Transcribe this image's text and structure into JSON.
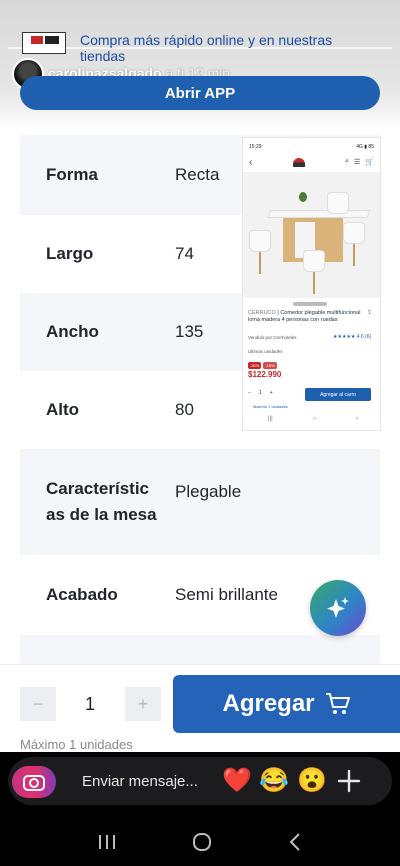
{
  "specs": [
    {
      "key": "Forma",
      "value": "Recta"
    },
    {
      "key": "Largo",
      "value": "74"
    },
    {
      "key": "Ancho",
      "value": "135"
    },
    {
      "key": "Alto",
      "value": "80"
    },
    {
      "key": "Características de la mesa",
      "key_display": "Característic\nas de la mesa",
      "value": "Plegable"
    },
    {
      "key": "Acabado",
      "value": "Semi brillante"
    }
  ],
  "story": {
    "promo_text": "Compra más rápido online y en nuestras tiendas",
    "username": "carolinazsalgado",
    "meta": "a ti  12 min",
    "open_app_label": "Abrir APP"
  },
  "shot": {
    "status_time": "15:29",
    "status_right": "4G ▮ 85",
    "title_brand": "CERRUCO",
    "title_text": "Comedor plegable multifuncional loma madera 4 personas con ruedas",
    "sold_by": "Vendido por Cerrhoteles",
    "rating": "★★★★★ 4.6 (6)",
    "badge": "Ultimas unidades",
    "tags": [
      "-30%",
      "-15%"
    ],
    "price": "$122.990",
    "qty": "1",
    "add_label": "Agregar al carro",
    "max_label": "Máximo 1 unidades"
  },
  "buy": {
    "minus": "−",
    "qty": "1",
    "plus": "+",
    "add_label": "Agregar",
    "max_units": "Máximo 1 unidades"
  },
  "composer": {
    "placeholder": "Enviar mensaje...",
    "quick_reactions": [
      "❤️",
      "😂",
      "😮"
    ]
  },
  "colors": {
    "accent_blue": "#2463b8",
    "brand_red": "#c62828"
  }
}
